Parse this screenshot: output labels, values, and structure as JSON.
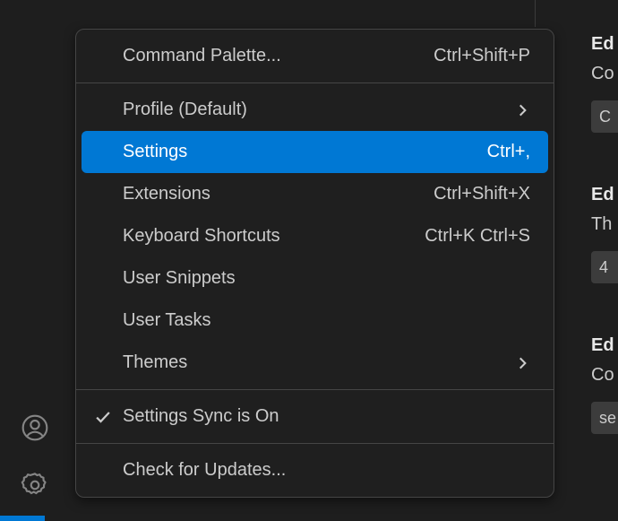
{
  "activity": {
    "account_icon": "account",
    "settings_icon": "gear"
  },
  "menu": {
    "command_palette": {
      "label": "Command Palette...",
      "shortcut": "Ctrl+Shift+P"
    },
    "profile": {
      "label": "Profile (Default)"
    },
    "settings": {
      "label": "Settings",
      "shortcut": "Ctrl+,"
    },
    "extensions": {
      "label": "Extensions",
      "shortcut": "Ctrl+Shift+X"
    },
    "keyboard_shortcuts": {
      "label": "Keyboard Shortcuts",
      "shortcut": "Ctrl+K Ctrl+S"
    },
    "user_snippets": {
      "label": "User Snippets"
    },
    "user_tasks": {
      "label": "User Tasks"
    },
    "themes": {
      "label": "Themes"
    },
    "settings_sync": {
      "label": "Settings Sync is On"
    },
    "check_updates": {
      "label": "Check for Updates..."
    }
  },
  "right": {
    "h1": "Ed",
    "t1": "Co",
    "v1": "C",
    "h2": "Ed",
    "t2": "Th",
    "v2": "4",
    "h3": "Ed",
    "t3": "Co",
    "v3": "se"
  }
}
